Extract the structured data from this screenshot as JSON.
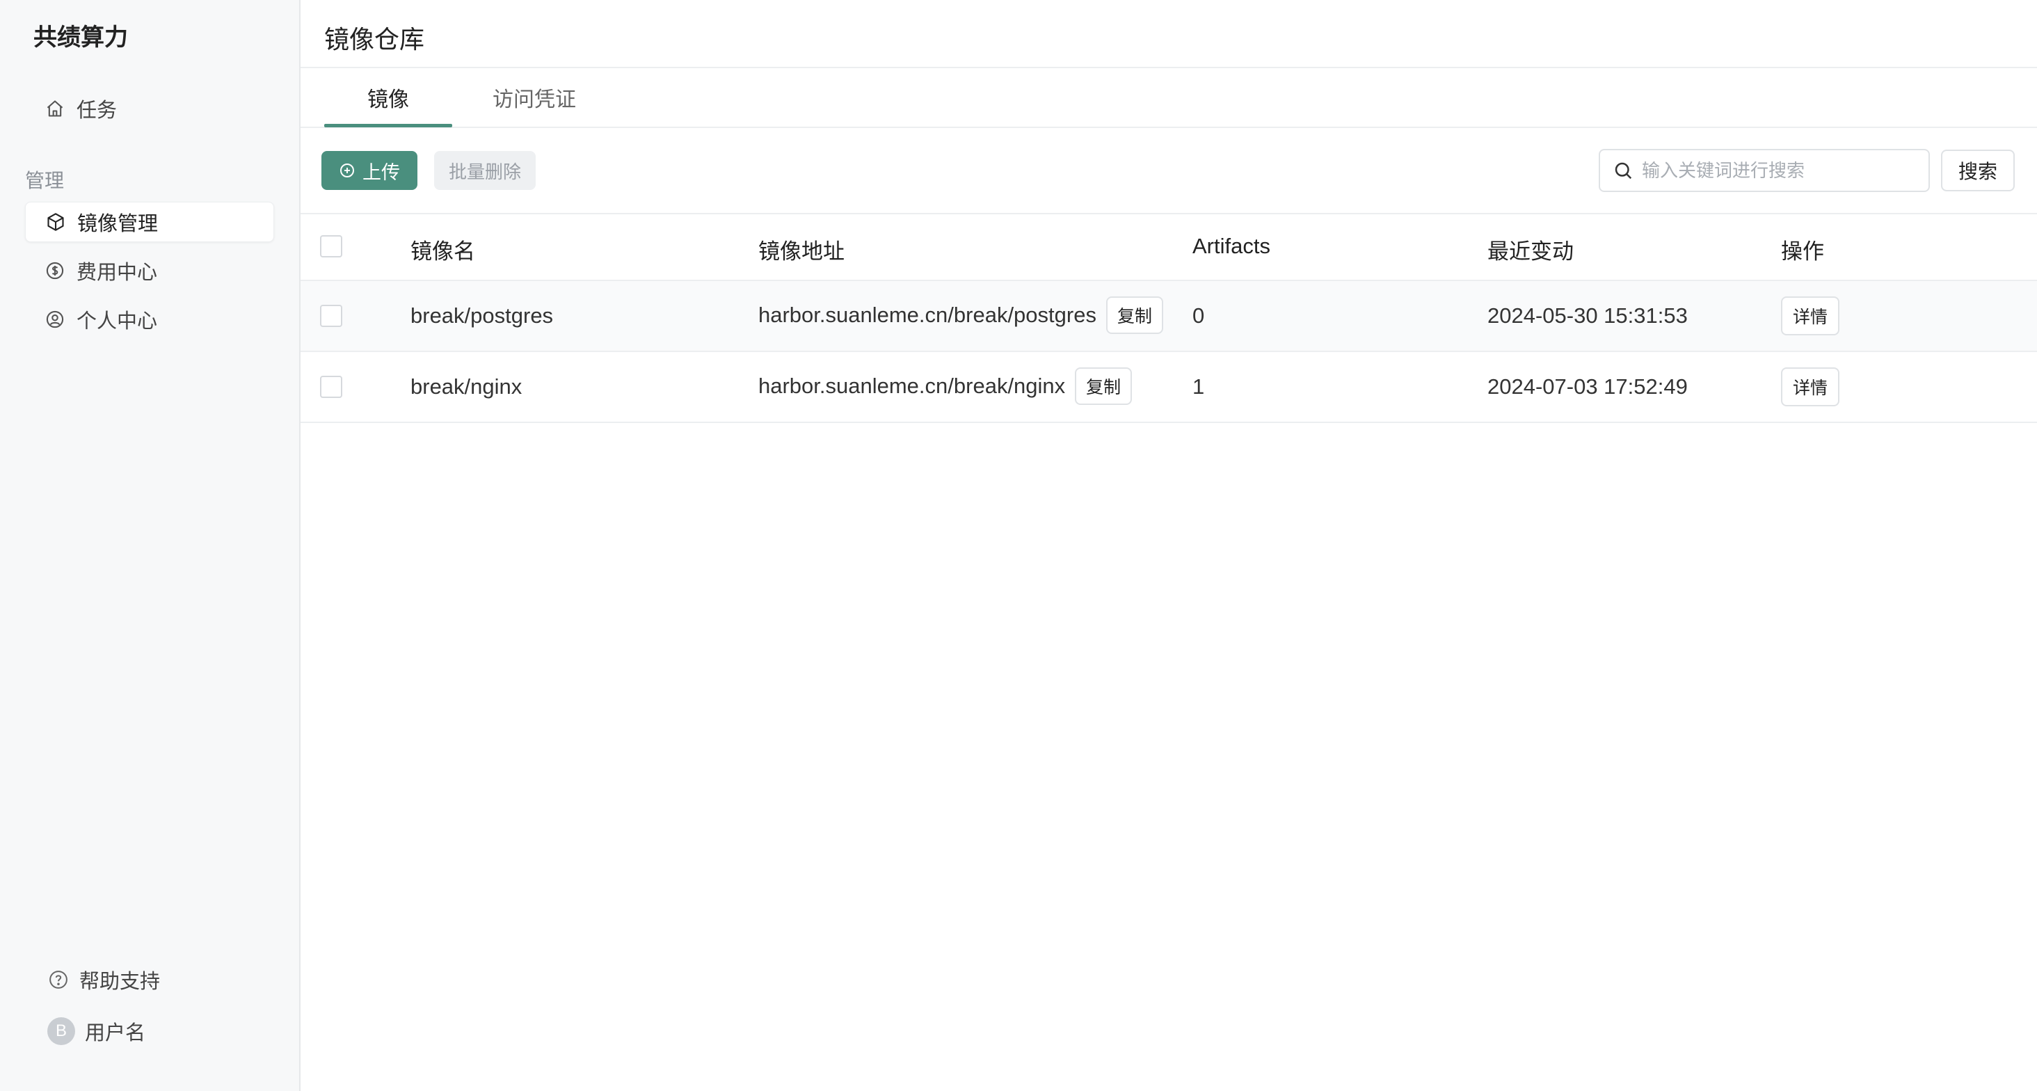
{
  "app": {
    "brand": "共绩算力"
  },
  "sidebar": {
    "items": [
      {
        "label": "任务",
        "icon": "home-icon"
      }
    ],
    "section_label": "管理",
    "manage_items": [
      {
        "label": "镜像管理",
        "icon": "cube-icon",
        "active": true
      },
      {
        "label": "费用中心",
        "icon": "dollar-circle-icon",
        "active": false
      },
      {
        "label": "个人中心",
        "icon": "user-circle-icon",
        "active": false
      }
    ],
    "help": {
      "label": "帮助支持",
      "icon": "help-circle-icon"
    },
    "user": {
      "avatar_letter": "B",
      "name": "用户名"
    }
  },
  "page": {
    "title": "镜像仓库",
    "tabs": [
      {
        "label": "镜像",
        "active": true
      },
      {
        "label": "访问凭证",
        "active": false
      }
    ]
  },
  "toolbar": {
    "upload_label": "上传",
    "batch_delete_label": "批量删除",
    "search_placeholder": "输入关键词进行搜索",
    "search_button": "搜索"
  },
  "table": {
    "columns": [
      "镜像名",
      "镜像地址",
      "Artifacts",
      "最近变动",
      "操作"
    ],
    "copy_label": "复制",
    "detail_label": "详情",
    "rows": [
      {
        "name": "break/postgres",
        "address": "harbor.suanleme.cn/break/postgres",
        "artifacts": "0",
        "updated": "2024-05-30 15:31:53"
      },
      {
        "name": "break/nginx",
        "address": "harbor.suanleme.cn/break/nginx",
        "artifacts": "1",
        "updated": "2024-07-03 17:52:49"
      }
    ]
  },
  "colors": {
    "accent": "#4a8f7e",
    "sidebar_bg": "#f7f8f9"
  }
}
